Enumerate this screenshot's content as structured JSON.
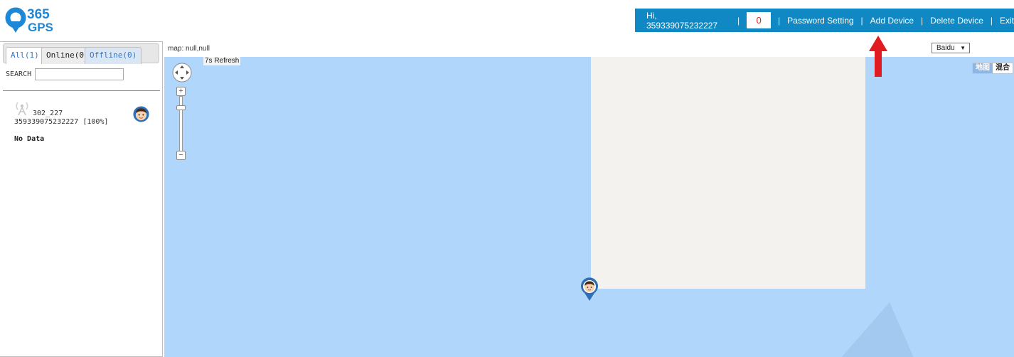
{
  "logo": {
    "text": "365 GPS"
  },
  "header": {
    "greeting": "Hi, 359339075232227",
    "alarm_count": "0",
    "separator": "|",
    "links": [
      "Password Setting",
      "Add Device",
      "Delete Device",
      "Exit"
    ]
  },
  "sidebar": {
    "tabs": [
      {
        "label": "All(1)",
        "active": true
      },
      {
        "label": "Online(0)",
        "active": false
      },
      {
        "label": "Offline(0)",
        "active": false
      }
    ],
    "search": {
      "label": "SEARCH",
      "value": ""
    },
    "devices": [
      {
        "name": "302_227",
        "imei_status": "359339075232227 [100%]",
        "icon": "signal-tower-icon",
        "avatar": "boy-avatar-icon"
      }
    ],
    "no_data": "No Data"
  },
  "map": {
    "coords": "map: null,null",
    "refresh": "7s Refresh",
    "provider": {
      "selected": "Baidu"
    },
    "map_types": [
      {
        "label": "地图",
        "active": true
      },
      {
        "label": "混合",
        "active": false
      }
    ]
  },
  "colors": {
    "topbar": "#0f88c4",
    "water": "#b1d6fb",
    "land": "#f3f2ef",
    "accent_red": "#e11b22",
    "tab_link": "#3a78c3"
  }
}
